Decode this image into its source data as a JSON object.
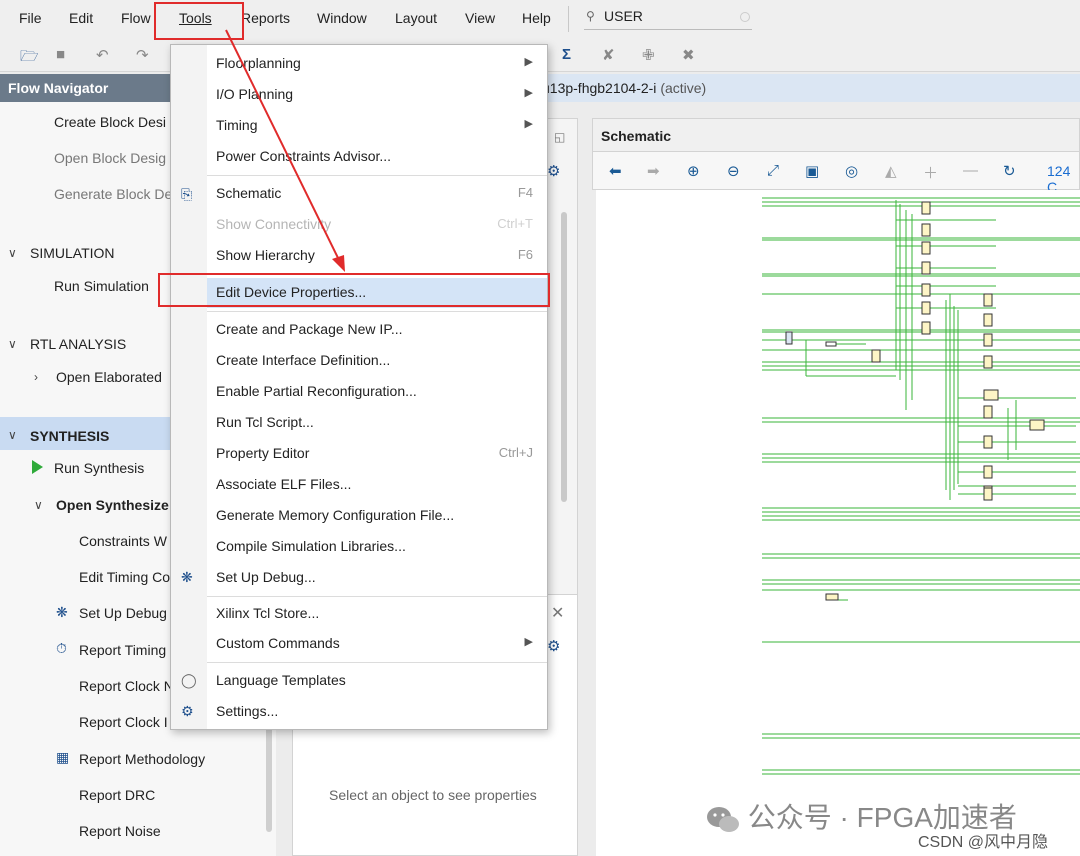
{
  "menubar": {
    "items": [
      "File",
      "Edit",
      "Flow",
      "Tools",
      "Reports",
      "Window",
      "Layout",
      "View",
      "Help"
    ],
    "search_value": "USER"
  },
  "project_bar": {
    "part": "u13p-fhgb2104-2-i",
    "status": "(active)"
  },
  "flow_navigator": {
    "title": "Flow Navigator",
    "items": {
      "create_block": "Create Block Desi",
      "open_block": "Open Block Desig",
      "generate_block": "Generate Block De",
      "simulation": "SIMULATION",
      "run_simulation": "Run Simulation",
      "rtl_analysis": "RTL ANALYSIS",
      "open_elaborated": "Open Elaborated",
      "synthesis": "SYNTHESIS",
      "run_synthesis": "Run Synthesis",
      "open_synthesized": "Open Synthesize",
      "constraints": "Constraints W",
      "edit_timing": "Edit Timing Co",
      "set_up_debug": "Set Up Debug",
      "report_timing": "Report Timing",
      "report_clock_1": "Report Clock N",
      "report_clock_2": "Report Clock I",
      "report_methodology": "Report Methodology",
      "report_drc": "Report DRC",
      "report_noise": "Report Noise"
    }
  },
  "tools_menu": {
    "floorplanning": "Floorplanning",
    "io_planning": "I/O Planning",
    "timing": "Timing",
    "power_constraints": "Power Constraints Advisor...",
    "schematic": "Schematic",
    "schematic_key": "F4",
    "show_connectivity": "Show Connectivity",
    "show_connectivity_key": "Ctrl+T",
    "show_hierarchy": "Show Hierarchy",
    "show_hierarchy_key": "F6",
    "edit_device_properties": "Edit Device Properties...",
    "create_package_ip": "Create and Package New IP...",
    "create_interface": "Create Interface Definition...",
    "enable_partial": "Enable Partial Reconfiguration...",
    "run_tcl": "Run Tcl Script...",
    "property_editor": "Property Editor",
    "property_editor_key": "Ctrl+J",
    "associate_elf": "Associate ELF Files...",
    "generate_memory": "Generate Memory Configuration File...",
    "compile_sim": "Compile Simulation Libraries...",
    "set_up_debug": "Set Up Debug...",
    "tcl_store": "Xilinx Tcl Store...",
    "custom_commands": "Custom Commands",
    "language_templates": "Language Templates",
    "settings": "Settings..."
  },
  "properties_panel": {
    "empty_message": "Select an object to see properties"
  },
  "schematic": {
    "title": "Schematic",
    "count": "124 C"
  },
  "watermark": {
    "wechat": "公众号 · FPGA加速者",
    "csdn": "CSDN @风中月隐"
  },
  "colors": {
    "highlight": "#d4e4f7",
    "annotation_red": "#e02b2b",
    "wire_green": "#33b233",
    "navigator_header": "#6b7a8a"
  }
}
